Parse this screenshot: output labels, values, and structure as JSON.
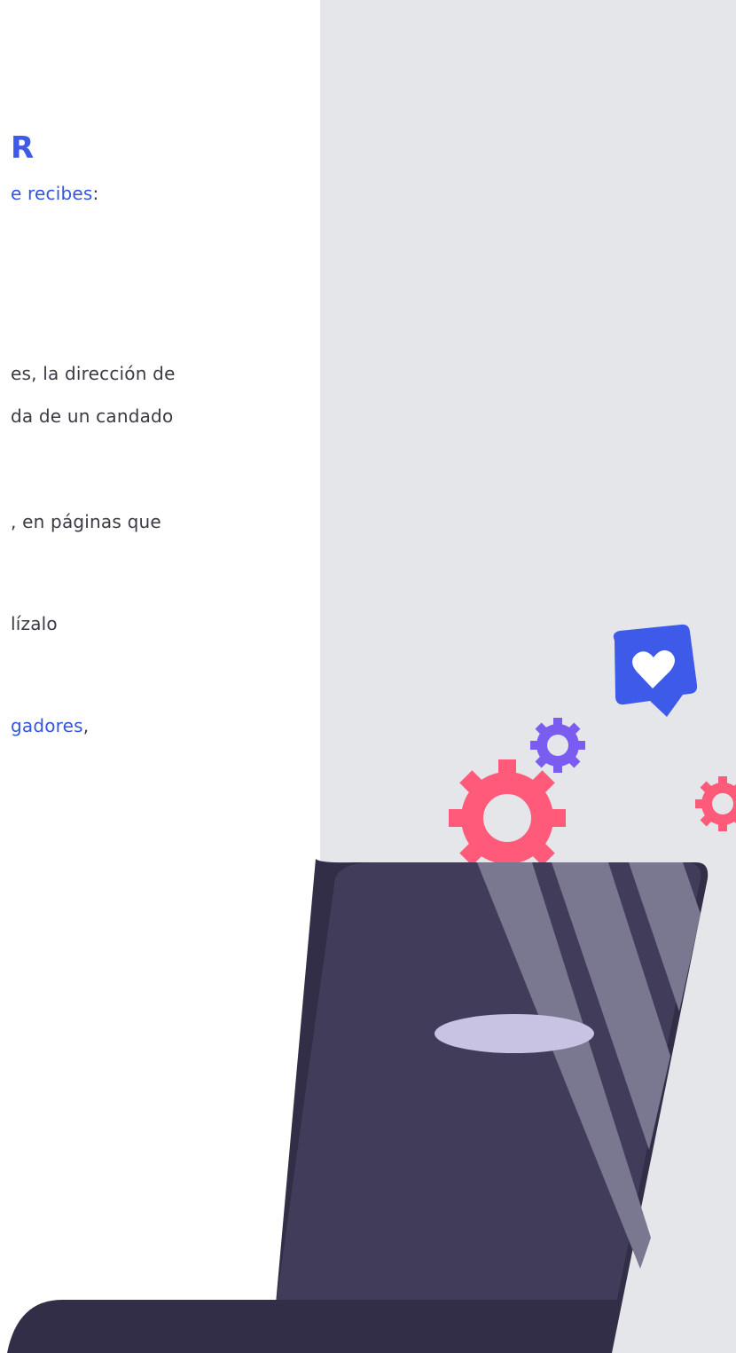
{
  "article": {
    "heading_fragment": "R",
    "line1": {
      "link": "e recibes",
      "after": ":"
    },
    "line2": "es, la dirección de",
    "line3": "da de un candado",
    "line4": ", en páginas que",
    "line5": "lízalo",
    "line6": {
      "link": "gadores",
      "after": ","
    }
  },
  "illustration": {
    "icons": [
      "heart-speech-bubble-icon",
      "gear-icon",
      "gear-icon",
      "gear-icon",
      "laptop-screen-icon"
    ],
    "colors": {
      "panel_bg": "#e5e6e9",
      "accent_blue": "#3d5ae8",
      "gear_pink": "#ff5a7a",
      "gear_purple": "#7a5cf0",
      "laptop_dark": "#413c59",
      "laptop_darker": "#332e47",
      "stripe": "#7a7890",
      "oval": "#c9c3e3"
    }
  }
}
